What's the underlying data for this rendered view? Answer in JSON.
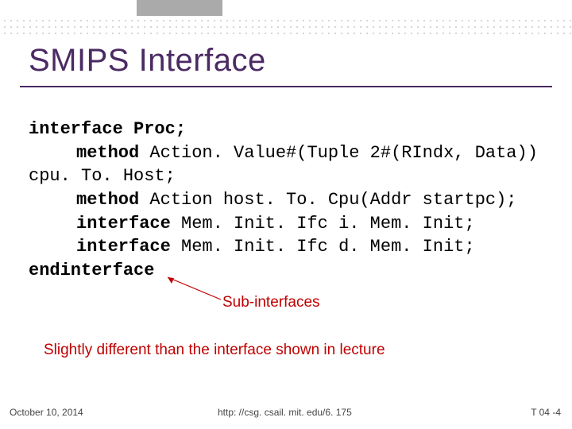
{
  "title": "SMIPS Interface",
  "code": {
    "l1": "interface Proc;",
    "l2a": "method",
    "l2b": " Action. Value#(Tuple 2#(RIndx, Data)) cpu. To. Host;",
    "l3a": "method",
    "l3b": " Action host. To. Cpu(Addr startpc);",
    "l4a": "interface",
    "l4b": " Mem. Init. Ifc i. Mem. Init;",
    "l5a": "interface",
    "l5b": " Mem. Init. Ifc d. Mem. Init;",
    "l6": "endinterface"
  },
  "annotation": "Sub-interfaces",
  "note": "Slightly different than the interface shown in lecture",
  "footer": {
    "date": "October 10, 2014",
    "url": "http: //csg. csail. mit. edu/6. 175",
    "page": "T 04 -4"
  }
}
